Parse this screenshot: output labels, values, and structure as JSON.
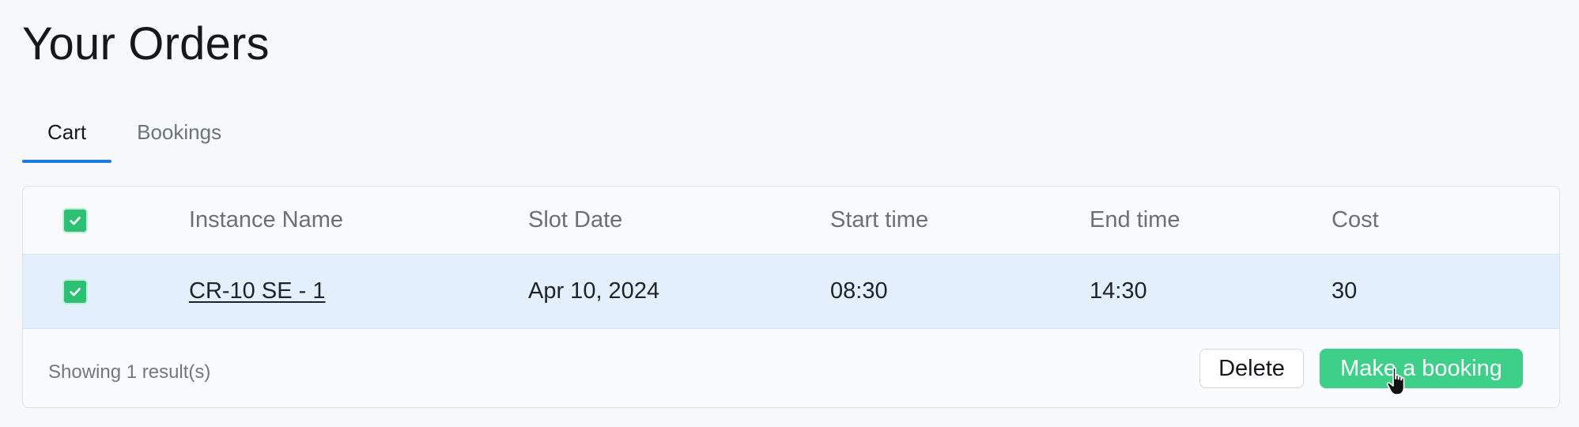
{
  "page": {
    "title": "Your Orders"
  },
  "tabs": [
    {
      "label": "Cart",
      "active": true
    },
    {
      "label": "Bookings",
      "active": false
    }
  ],
  "table": {
    "columns": [
      "Instance Name",
      "Slot Date",
      "Start time",
      "End time",
      "Cost"
    ],
    "header_checkbox_checked": true,
    "rows": [
      {
        "checked": true,
        "instance_name": "CR-10 SE - 1",
        "slot_date": "Apr 10, 2024",
        "start_time": "08:30",
        "end_time": "14:30",
        "cost": "30"
      }
    ]
  },
  "footer": {
    "result_text": "Showing 1 result(s)",
    "delete_label": "Delete",
    "book_label": "Make a booking"
  },
  "colors": {
    "accent_tab": "#1d7ae0",
    "checkbox_green": "#2bc072",
    "primary_button": "#3ecf88",
    "selected_row": "#e3effd"
  },
  "icons": {
    "checkbox": "check-icon",
    "cursor": "hand-pointer-icon"
  }
}
